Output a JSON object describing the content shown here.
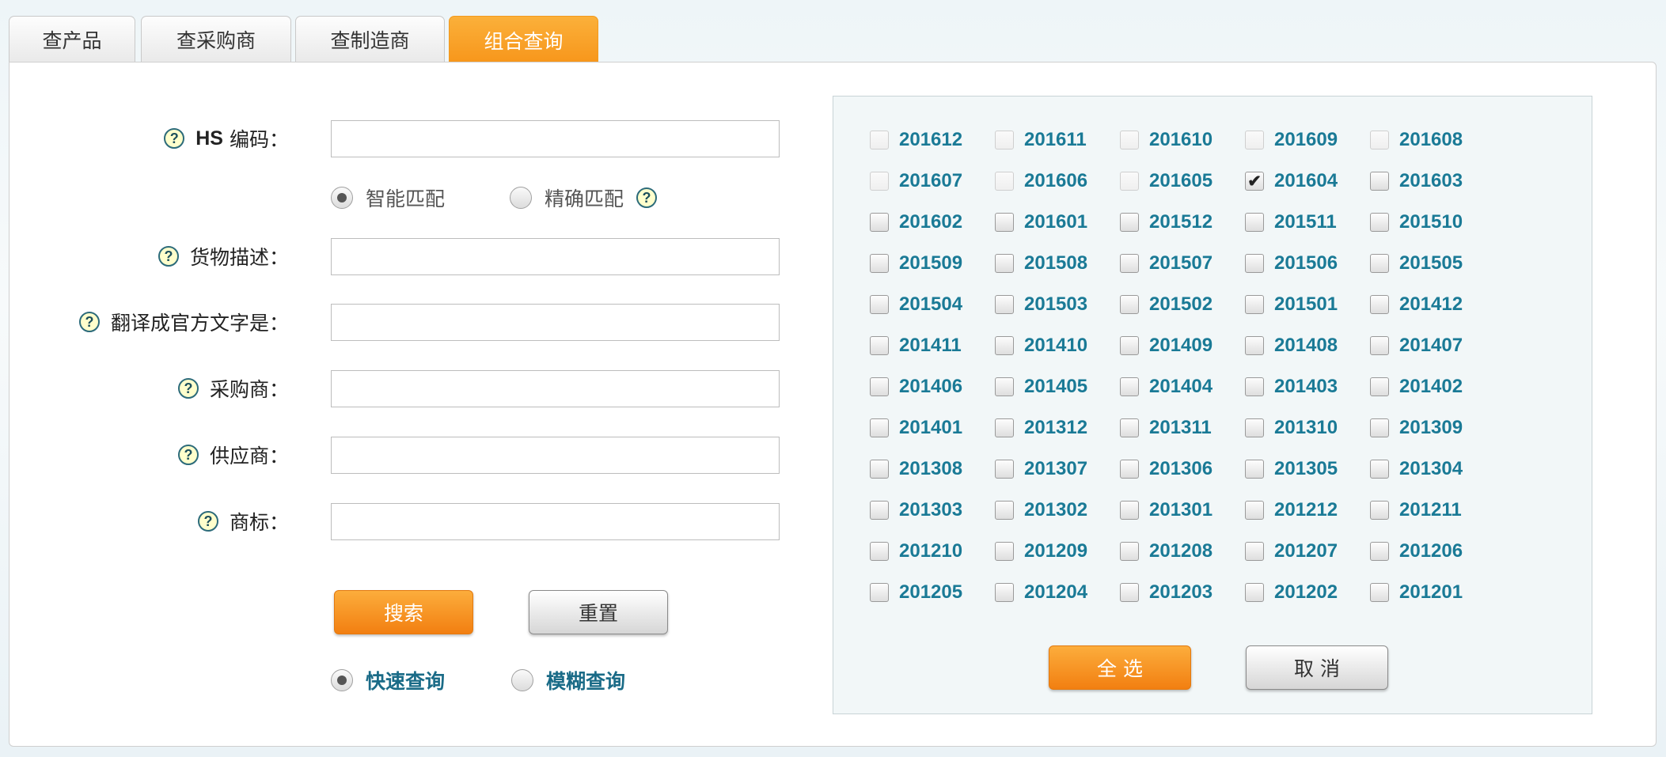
{
  "tabs": [
    {
      "label": "查产品",
      "active": false
    },
    {
      "label": "查采购商",
      "active": false
    },
    {
      "label": "查制造商",
      "active": false
    },
    {
      "label": "组合查询",
      "active": true
    }
  ],
  "form": {
    "hs_label_en": "HS",
    "hs_label": "编码：",
    "hs_value": "",
    "match_smart": "智能匹配",
    "match_exact": "精确匹配",
    "desc_label": "货物描述：",
    "desc_value": "",
    "translate_label": "翻译成官方文字是：",
    "translate_value": "",
    "buyer_label": "采购商：",
    "buyer_value": "",
    "supplier_label": "供应商：",
    "supplier_value": "",
    "brand_label": "商标：",
    "brand_value": "",
    "search_button": "搜索",
    "reset_button": "重置",
    "quick_query": "快速查询",
    "fuzzy_query": "模糊查询",
    "help_glyph": "?"
  },
  "months": {
    "items": [
      "201612",
      "201611",
      "201610",
      "201609",
      "201608",
      "201607",
      "201606",
      "201605",
      "201604",
      "201603",
      "201602",
      "201601",
      "201512",
      "201511",
      "201510",
      "201509",
      "201508",
      "201507",
      "201506",
      "201505",
      "201504",
      "201503",
      "201502",
      "201501",
      "201412",
      "201411",
      "201410",
      "201409",
      "201408",
      "201407",
      "201406",
      "201405",
      "201404",
      "201403",
      "201402",
      "201401",
      "201312",
      "201311",
      "201310",
      "201309",
      "201308",
      "201307",
      "201306",
      "201305",
      "201304",
      "201303",
      "201302",
      "201301",
      "201212",
      "201211",
      "201210",
      "201209",
      "201208",
      "201207",
      "201206",
      "201205",
      "201204",
      "201203",
      "201202",
      "201201"
    ],
    "checked": [
      "201604"
    ],
    "disabled": [
      "201612",
      "201611",
      "201610",
      "201609",
      "201608",
      "201607",
      "201606",
      "201605"
    ],
    "select_all_button": "全 选",
    "cancel_button": "取 消"
  },
  "colors": {
    "accent": "#f7961b",
    "link": "#1a7a96"
  }
}
